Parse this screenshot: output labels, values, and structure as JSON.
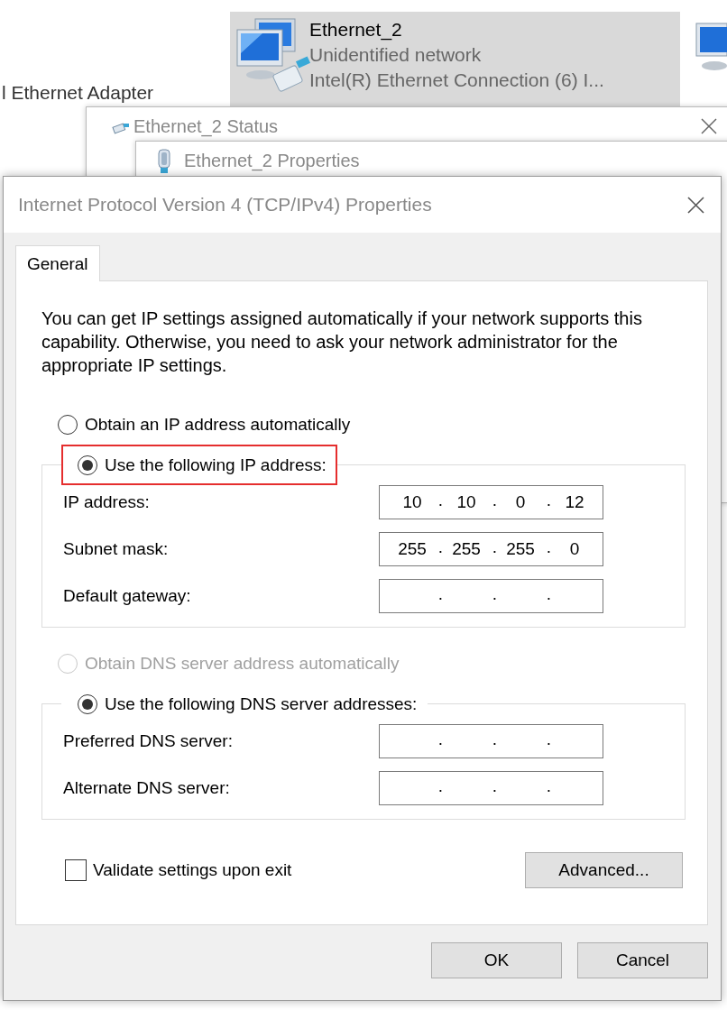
{
  "background": {
    "adapter_label": "l Ethernet Adapter",
    "adapter": {
      "name": "Ethernet_2",
      "status": "Unidentified network",
      "device": "Intel(R) Ethernet Connection (6) I...",
      "selected": true
    }
  },
  "windows": [
    {
      "title": "Ethernet_2 Status"
    },
    {
      "title": "Ethernet_2 Properties"
    }
  ],
  "dialog": {
    "title": "Internet Protocol Version 4 (TCP/IPv4) Properties",
    "tabs": [
      {
        "label": "General",
        "selected": true
      }
    ],
    "description": "You can get IP settings assigned automatically if your network supports this capability. Otherwise, you need to ask your network administrator for the appropriate IP settings.",
    "sections": [
      {
        "options": [
          {
            "label": "Obtain an IP address automatically",
            "selected": false,
            "disabled": false,
            "highlighted": false
          },
          {
            "label": "Use the following IP address:",
            "selected": true,
            "disabled": false,
            "highlighted": true
          }
        ],
        "fields": [
          {
            "label": "IP address:",
            "octets": [
              {
                "text": "10",
                "dot": "."
              },
              {
                "text": "10",
                "dot": "."
              },
              {
                "text": "0",
                "dot": "."
              },
              {
                "text": "12"
              }
            ]
          },
          {
            "label": "Subnet mask:",
            "octets": [
              {
                "text": "255",
                "dot": "."
              },
              {
                "text": "255",
                "dot": "."
              },
              {
                "text": "255",
                "dot": "."
              },
              {
                "text": "0"
              }
            ]
          },
          {
            "label": "Default gateway:",
            "octets": [
              {
                "dot": "."
              },
              {
                "dot": "."
              },
              {
                "dot": "."
              }
            ]
          }
        ]
      },
      {
        "options": [
          {
            "label": "Obtain DNS server address automatically",
            "selected": false,
            "disabled": true,
            "highlighted": false
          },
          {
            "label": "Use the following DNS server addresses:",
            "selected": true,
            "disabled": false,
            "highlighted": false
          }
        ],
        "fields": [
          {
            "label": "Preferred DNS server:",
            "octets": [
              {
                "dot": "."
              },
              {
                "dot": "."
              },
              {
                "dot": "."
              }
            ]
          },
          {
            "label": "Alternate DNS server:",
            "octets": [
              {
                "dot": "."
              },
              {
                "dot": "."
              },
              {
                "dot": "."
              }
            ]
          }
        ]
      }
    ],
    "validate": {
      "label": "Validate settings upon exit",
      "checked": false
    },
    "advanced_button": "Advanced...",
    "buttons": [
      "OK",
      "Cancel"
    ]
  }
}
